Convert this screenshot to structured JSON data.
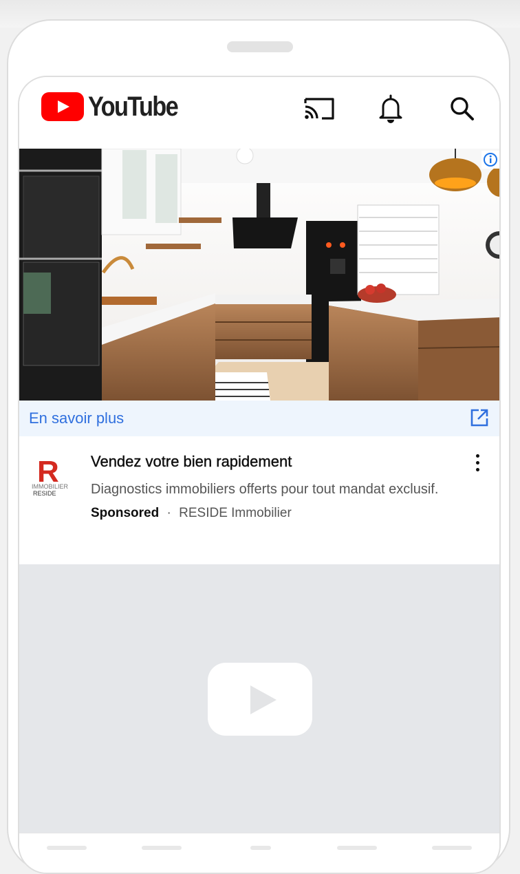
{
  "app": {
    "name": "YouTube"
  },
  "header": {
    "cast_icon": "cast-icon",
    "notifications_icon": "bell-icon",
    "search_icon": "search-icon"
  },
  "ad": {
    "image_description_icon": "info-icon",
    "cta_label": "En savoir plus",
    "cta_icon": "external-link-icon",
    "title": "Vendez votre bien rapidement",
    "description": "Diagnostics immobiliers offerts pour tout mandat exclusif.",
    "sponsored_label": "Sponsored",
    "separator": "·",
    "advertiser": "RESIDE Immobilier",
    "advertiser_logo": {
      "letter": "R",
      "line1": "IMMOBILIER",
      "line2": "RESIDE"
    },
    "menu_icon": "more-vert-icon"
  },
  "placeholder": {
    "icon": "youtube-play-icon"
  },
  "colors": {
    "brand_red": "#ff0000",
    "link_blue": "#2f6fde",
    "cta_bar_bg": "#eef5fd",
    "placeholder_bg": "#e5e7ea",
    "reside_red": "#d42a20"
  }
}
